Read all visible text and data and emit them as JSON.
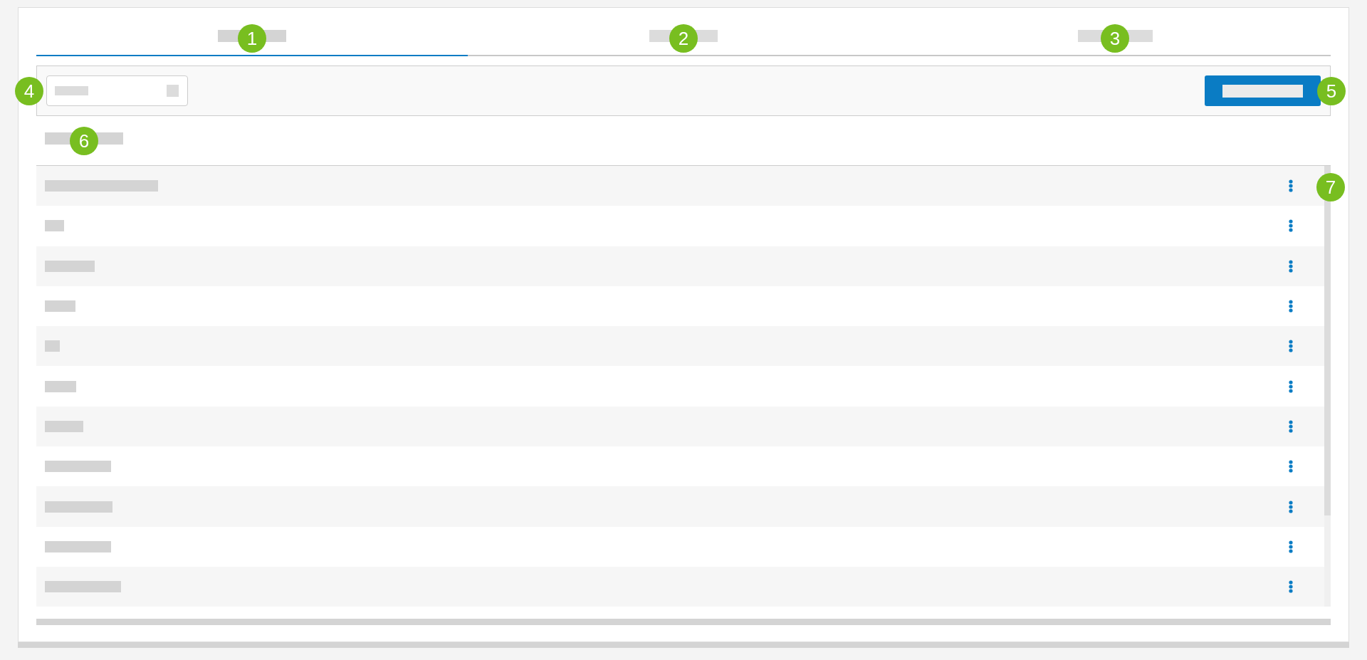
{
  "tabs": [
    {
      "selected": true,
      "callout": "1"
    },
    {
      "selected": false,
      "callout": "2"
    },
    {
      "selected": false,
      "callout": "3"
    }
  ],
  "toolbar": {
    "search": {
      "callout": "4"
    },
    "action_button": {
      "callout": "5"
    }
  },
  "list": {
    "heading": {
      "callout": "6"
    },
    "callout": "7",
    "rows": [
      {
        "kind": "placeholder"
      },
      {
        "kind": "placeholder"
      },
      {
        "kind": "placeholder"
      },
      {
        "kind": "placeholder"
      },
      {
        "kind": "placeholder"
      },
      {
        "kind": "placeholder"
      },
      {
        "kind": "placeholder"
      },
      {
        "kind": "placeholder"
      },
      {
        "kind": "placeholder"
      },
      {
        "kind": "placeholder"
      },
      {
        "kind": "placeholder"
      }
    ]
  }
}
